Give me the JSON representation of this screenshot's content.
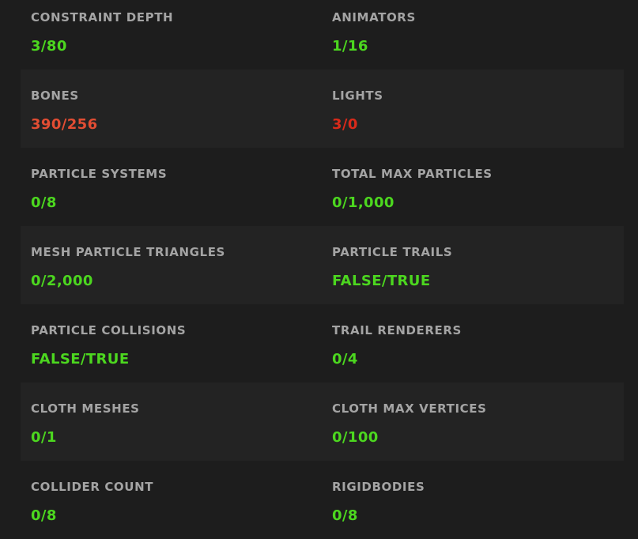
{
  "rows": [
    {
      "left": {
        "label": "CONSTRAINT DEPTH",
        "value": "3/80",
        "status": "ok"
      },
      "right": {
        "label": "ANIMATORS",
        "value": "1/16",
        "status": "ok"
      }
    },
    {
      "left": {
        "label": "BONES",
        "value": "390/256",
        "status": "over"
      },
      "right": {
        "label": "LIGHTS",
        "value": "3/0",
        "status": "over"
      }
    },
    {
      "left": {
        "label": "PARTICLE SYSTEMS",
        "value": "0/8",
        "status": "ok"
      },
      "right": {
        "label": "TOTAL MAX PARTICLES",
        "value": "0/1,000",
        "status": "ok"
      }
    },
    {
      "left": {
        "label": "MESH PARTICLE TRIANGLES",
        "value": "0/2,000",
        "status": "ok"
      },
      "right": {
        "label": "PARTICLE TRAILS",
        "value": "FALSE/TRUE",
        "status": "ok"
      }
    },
    {
      "left": {
        "label": "PARTICLE COLLISIONS",
        "value": "FALSE/TRUE",
        "status": "ok"
      },
      "right": {
        "label": "TRAIL RENDERERS",
        "value": "0/4",
        "status": "ok"
      }
    },
    {
      "left": {
        "label": "CLOTH MESHES",
        "value": "0/1",
        "status": "ok"
      },
      "right": {
        "label": "CLOTH MAX VERTICES",
        "value": "0/100",
        "status": "ok"
      }
    },
    {
      "left": {
        "label": "COLLIDER COUNT",
        "value": "0/8",
        "status": "ok"
      },
      "right": {
        "label": "RIGIDBODIES",
        "value": "0/8",
        "status": "ok"
      }
    }
  ],
  "colors": {
    "background": "#1d1d1d",
    "row_shade": "#232323",
    "label": "#a4a4a4",
    "ok": "#4cd71f",
    "over": "#e24d33",
    "over_alt": "#d92a1a"
  }
}
